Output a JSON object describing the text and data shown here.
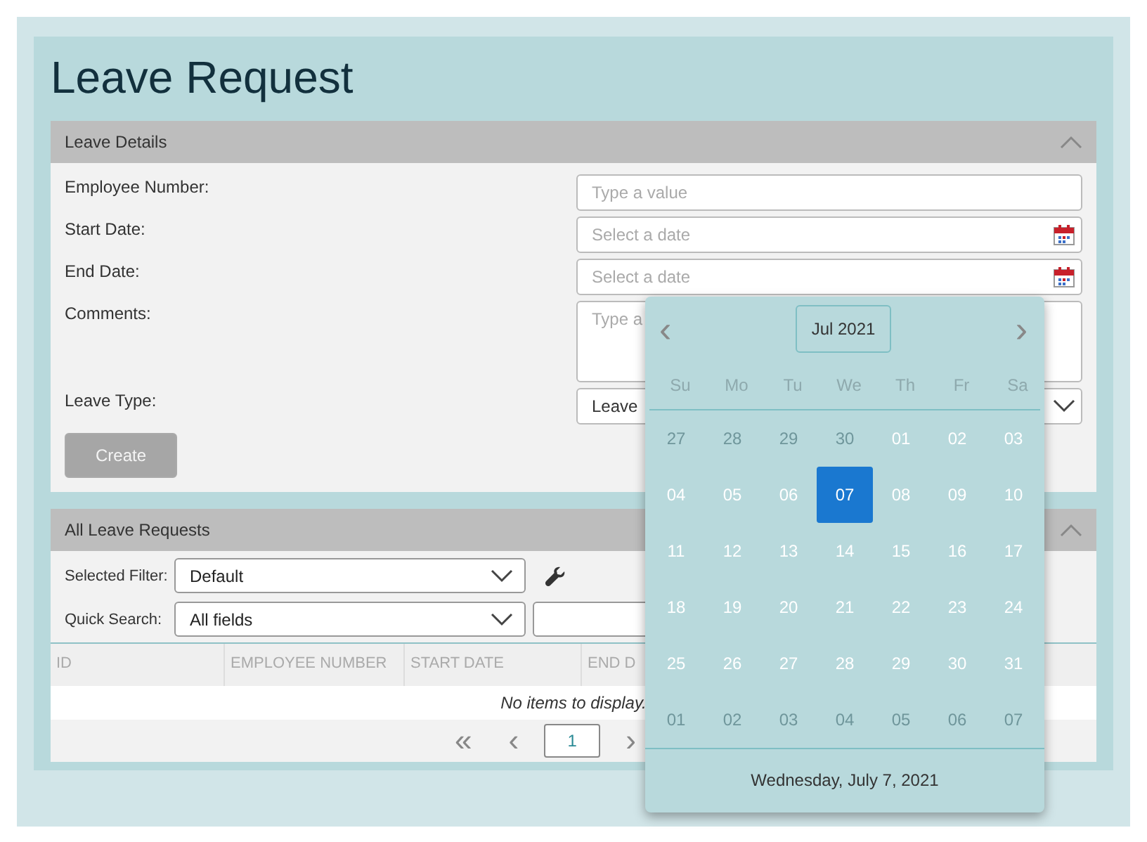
{
  "page": {
    "title": "Leave Request"
  },
  "leave_details": {
    "title": "Leave Details",
    "expanded": true,
    "fields": [
      {
        "kind": "text",
        "label": "Employee Number:",
        "placeholder": "Type a value"
      },
      {
        "kind": "date",
        "label": "Start Date:",
        "placeholder": "Select a date"
      },
      {
        "kind": "date",
        "label": "End Date:",
        "placeholder": "Select a date"
      },
      {
        "kind": "textarea",
        "label": "Comments:",
        "placeholder": "Type a"
      },
      {
        "kind": "select",
        "label": "Leave Type:",
        "value": "Leave"
      }
    ],
    "button": "Create"
  },
  "all_requests": {
    "title": "All Leave Requests",
    "expanded": true,
    "selected_filter": {
      "label": "Selected Filter:",
      "value": "Default"
    },
    "quick_search": {
      "label": "Quick Search:",
      "value": "All fields"
    },
    "table": {
      "columns": [
        "ID",
        "EMPLOYEE NUMBER",
        "START DATE",
        "END D"
      ],
      "empty_text": "No items to display."
    },
    "pager": {
      "first": "«",
      "prev": "‹",
      "page": "1",
      "next": "›"
    }
  },
  "date_picker": {
    "month": "Jul 2021",
    "prev": "‹",
    "next": "›",
    "weekdays": [
      "Su",
      "Mo",
      "Tu",
      "We",
      "Th",
      "Fr",
      "Sa"
    ],
    "weeks": [
      [
        {
          "label": "27",
          "muted": true,
          "selected": false
        },
        {
          "label": "28",
          "muted": true,
          "selected": false
        },
        {
          "label": "29",
          "muted": true,
          "selected": false
        },
        {
          "label": "30",
          "muted": true,
          "selected": false
        },
        {
          "label": "01",
          "muted": false,
          "selected": false
        },
        {
          "label": "02",
          "muted": false,
          "selected": false
        },
        {
          "label": "03",
          "muted": false,
          "selected": false
        }
      ],
      [
        {
          "label": "04",
          "muted": false,
          "selected": false
        },
        {
          "label": "05",
          "muted": false,
          "selected": false
        },
        {
          "label": "06",
          "muted": false,
          "selected": false
        },
        {
          "label": "07",
          "muted": false,
          "selected": true
        },
        {
          "label": "08",
          "muted": false,
          "selected": false
        },
        {
          "label": "09",
          "muted": false,
          "selected": false
        },
        {
          "label": "10",
          "muted": false,
          "selected": false
        }
      ],
      [
        {
          "label": "11",
          "muted": false,
          "selected": false
        },
        {
          "label": "12",
          "muted": false,
          "selected": false
        },
        {
          "label": "13",
          "muted": false,
          "selected": false
        },
        {
          "label": "14",
          "muted": false,
          "selected": false
        },
        {
          "label": "15",
          "muted": false,
          "selected": false
        },
        {
          "label": "16",
          "muted": false,
          "selected": false
        },
        {
          "label": "17",
          "muted": false,
          "selected": false
        }
      ],
      [
        {
          "label": "18",
          "muted": false,
          "selected": false
        },
        {
          "label": "19",
          "muted": false,
          "selected": false
        },
        {
          "label": "20",
          "muted": false,
          "selected": false
        },
        {
          "label": "21",
          "muted": false,
          "selected": false
        },
        {
          "label": "22",
          "muted": false,
          "selected": false
        },
        {
          "label": "23",
          "muted": false,
          "selected": false
        },
        {
          "label": "24",
          "muted": false,
          "selected": false
        }
      ],
      [
        {
          "label": "25",
          "muted": false,
          "selected": false
        },
        {
          "label": "26",
          "muted": false,
          "selected": false
        },
        {
          "label": "27",
          "muted": false,
          "selected": false
        },
        {
          "label": "28",
          "muted": false,
          "selected": false
        },
        {
          "label": "29",
          "muted": false,
          "selected": false
        },
        {
          "label": "30",
          "muted": false,
          "selected": false
        },
        {
          "label": "31",
          "muted": false,
          "selected": false
        }
      ],
      [
        {
          "label": "01",
          "muted": true,
          "selected": false
        },
        {
          "label": "02",
          "muted": true,
          "selected": false
        },
        {
          "label": "03",
          "muted": true,
          "selected": false
        },
        {
          "label": "04",
          "muted": true,
          "selected": false
        },
        {
          "label": "05",
          "muted": true,
          "selected": false
        },
        {
          "label": "06",
          "muted": true,
          "selected": false
        },
        {
          "label": "07",
          "muted": true,
          "selected": false
        }
      ]
    ],
    "footer": "Wednesday, July 7, 2021"
  }
}
